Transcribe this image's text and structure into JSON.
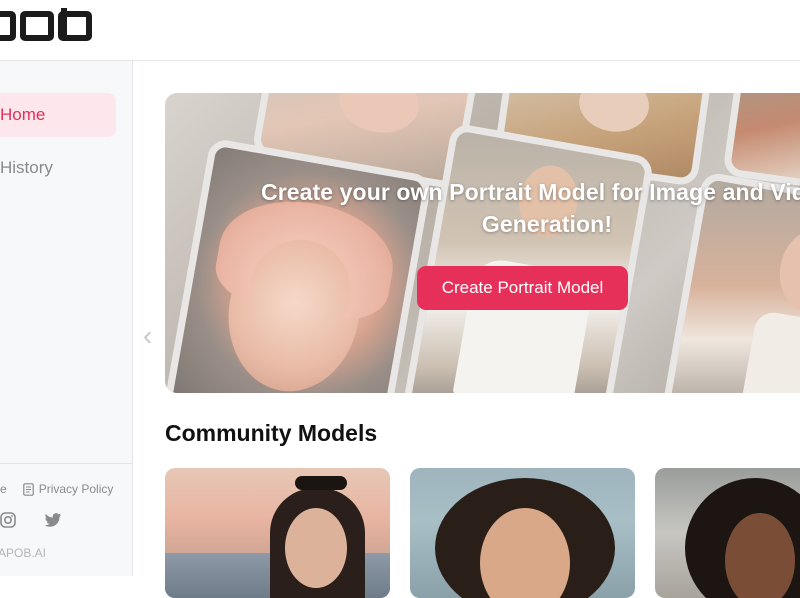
{
  "header": {
    "logo_text": "APOB"
  },
  "sidebar": {
    "items": [
      {
        "label": "Home",
        "active": true
      },
      {
        "label": "History",
        "active": false
      }
    ],
    "footer": {
      "link_partial": "ce",
      "privacy_label": "Privacy Policy",
      "social": [
        "instagram-icon",
        "twitter-icon"
      ],
      "copyright": "APOB.AI"
    }
  },
  "banner": {
    "title_line1": "Create your own Portrait Model for Image and Video",
    "title_line2": "Generation!",
    "cta_label": "Create Portrait Model"
  },
  "community": {
    "title": "Community Models",
    "cards": [
      "model-1",
      "model-2",
      "model-3"
    ]
  },
  "colors": {
    "accent": "#e6305a",
    "active_bg": "#fde7ec",
    "sidebar_bg": "#f7f8fa"
  }
}
